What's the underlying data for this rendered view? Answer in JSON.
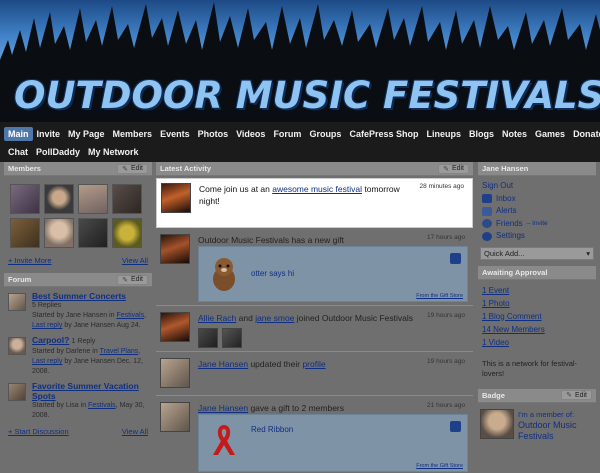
{
  "site": {
    "title": "OUTDOOR MUSIC FESTIVALS"
  },
  "nav": {
    "row1": [
      "Main",
      "Invite",
      "My Page",
      "Members",
      "Events",
      "Photos",
      "Videos",
      "Forum",
      "Groups",
      "CafePress Shop",
      "Lineups",
      "Blogs",
      "Notes",
      "Games",
      "Donate"
    ],
    "row2": [
      "Chat",
      "PollDaddy",
      "My Network"
    ]
  },
  "members": {
    "title": "Members",
    "edit": "Edit",
    "invite_more": "+ Invite More",
    "view_all": "View All"
  },
  "forum": {
    "title": "Forum",
    "edit": "Edit",
    "items": [
      {
        "title": "Best Summer Concerts",
        "replies": "5 Replies",
        "started_prefix": "Started by Jane Hansen in",
        "category": "Festivals",
        "last_reply": "Last reply",
        "last_by": "by Jane Hansen Aug 24."
      },
      {
        "title": "Carpool?",
        "replies": "1 Reply",
        "started_prefix": "Started by Darlene in",
        "category": "Travel Plans",
        "last_reply": "Last reply",
        "last_by": "by Jane Hansen Dec. 12, 2008."
      },
      {
        "title": "Favorite Summer Vacation Spots",
        "replies": "",
        "started_prefix": "Started by Lisa in",
        "category": "Festivals",
        "last_reply": "",
        "last_by": "May 30, 2008."
      }
    ],
    "start_discussion": "+ Start Discussion",
    "view_all": "View All"
  },
  "activity": {
    "title": "Latest Activity",
    "edit": "Edit",
    "items": [
      {
        "text_before": "Come join us at an ",
        "link": "awesome music festival",
        "text_after": " tomorrow",
        "line2": "night!",
        "time": "28 minutes ago"
      },
      {
        "text": "Outdoor Music Festivals has a new gift",
        "time": "17 hours ago",
        "gift_label": "otter says hi",
        "store": "From the Gift Store"
      },
      {
        "user1": "Allie Rach",
        "and": " and ",
        "user2": "jane smoe",
        "text": " joined Outdoor Music Festivals",
        "time": "19 hours ago"
      },
      {
        "user": "Jane Hansen",
        "text": " updated their ",
        "link": "profile",
        "time": "19 hours ago"
      },
      {
        "user": "Jane Hansen",
        "text": " gave a gift to 2 members",
        "time": "21 hours ago",
        "gift_label": "Red Ribbon",
        "store": "From the Gift Store"
      }
    ]
  },
  "user_panel": {
    "name": "Jane Hansen",
    "sign_out": "Sign Out",
    "inbox": "Inbox",
    "alerts": "Alerts",
    "friends": "Friends",
    "friends_invite": " – Invite",
    "settings": "Settings",
    "quick_add": "Quick Add...",
    "quick_add_arrow": "▾"
  },
  "awaiting": {
    "title": "Awaiting Approval",
    "items": [
      "1 Event",
      "1 Photo",
      "1 Blog Comment",
      "14 New Members",
      "1 Video"
    ]
  },
  "network_note": "This is a network for festival-lovers!",
  "badge": {
    "title": "Badge",
    "edit": "Edit",
    "line1": "I'm a member of:",
    "line2": "Outdoor Music",
    "line3": "Festivals"
  },
  "icons": {
    "edit": "pencil-icon",
    "inbox": "inbox-icon",
    "alerts": "alert-icon",
    "friends": "friends-icon",
    "settings": "gear-icon",
    "gift": "gift-icon"
  },
  "colors": {
    "nav_bg": "#1b1b1b",
    "nav_active": "#4f77a8",
    "link": "#0f2f82",
    "highlight": "#ffffff"
  }
}
